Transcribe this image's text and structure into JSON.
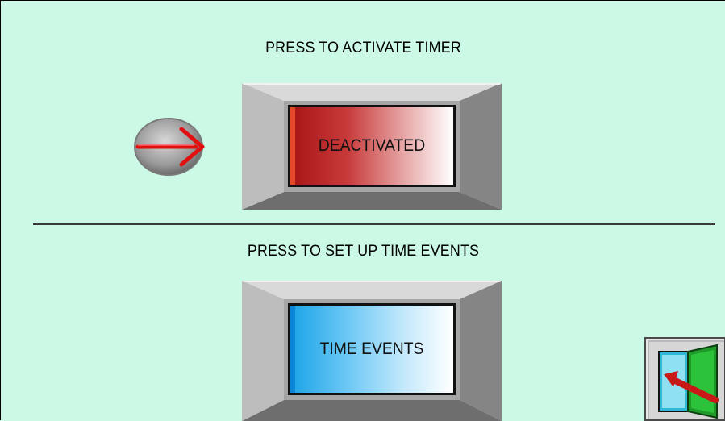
{
  "timer_section": {
    "heading": "PRESS TO ACTIVATE TIMER",
    "button_label": "DEACTIVATED",
    "status_color": "#b52020"
  },
  "events_section": {
    "heading": "PRESS TO SET UP TIME EVENTS",
    "button_label": "TIME EVENTS",
    "accent_color": "#1aa3e8"
  },
  "background_color": "#ccf9e6",
  "icons": {
    "indicator": "red-arrow-right-icon",
    "exit": "exit-door-icon"
  }
}
